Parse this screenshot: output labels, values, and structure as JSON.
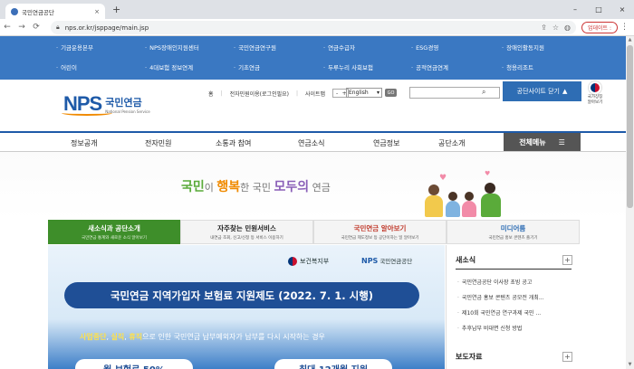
{
  "browser": {
    "tab_title": "국민연금공단",
    "tab_close": "×",
    "new_tab": "+",
    "win_min": "–",
    "win_max": "□",
    "win_close": "×",
    "back": "←",
    "forward": "→",
    "reload": "⟳",
    "url": "nps.or.kr/jsppage/main.jsp",
    "update_button": "업데이트 :",
    "menu": "⋮"
  },
  "site_nav": [
    {
      "label": "기금운용본부"
    },
    {
      "label": "NPS장애인지원센터"
    },
    {
      "label": "국민연금연구원"
    },
    {
      "label": "연금수급자"
    },
    {
      "label": "ESG경영"
    },
    {
      "label": "장애인활동지원"
    },
    {
      "label": "어린이"
    },
    {
      "label": "4대보험 정보연계"
    },
    {
      "label": "기초연금"
    },
    {
      "label": "두루누리 사회보험"
    },
    {
      "label": "공적연금연계"
    },
    {
      "label": "청용리조트"
    }
  ],
  "header": {
    "logo_nps": "NPS",
    "logo_kor": "국민연금",
    "logo_eng": "National Pension Service",
    "util_links": [
      "홈",
      "전자민원이용(로그인필요)",
      "사이트맵"
    ],
    "font_minus": "-",
    "font_plus": "+",
    "language": "English",
    "go_label": "GO",
    "shortcut_label": "공단사이트 닫기",
    "shortcut_arrow": "▲",
    "emblem_line1": "국가상징",
    "emblem_line2": "알아보기"
  },
  "main_menu": [
    {
      "label": "정보공개"
    },
    {
      "label": "전자민원"
    },
    {
      "label": "소통과 참여"
    },
    {
      "label": "연금소식"
    },
    {
      "label": "연금정보"
    },
    {
      "label": "공단소개"
    }
  ],
  "all_menu": {
    "label": "전체메뉴",
    "icon": "☰"
  },
  "hero": {
    "slogan_part1": "국민",
    "slogan_part2": "이 ",
    "slogan_part3": "행복",
    "slogan_part4": "한 국민 ",
    "slogan_part5": "모두의",
    "slogan_part6": " 연금"
  },
  "content_tabs": [
    {
      "title": "새소식과 공단소개",
      "subtitle": "국민연금 통계와 새로운 소식 알아보기",
      "active": true
    },
    {
      "title": "자주찾는 민원서비스",
      "subtitle": "내연금 조회, 신고/신청 등 서비스 이용하기",
      "active": false
    },
    {
      "title": "국민연금 알아보기",
      "subtitle": "국민연금 제도정보 등 공단이하는 일 알아보기",
      "active": false
    },
    {
      "title": "미디어룸",
      "subtitle": "국민연금 홍보 콘텐츠 즐기기",
      "active": false
    }
  ],
  "banner": {
    "ministry": "보건복지부",
    "nps_label": "NPS",
    "nps_name": "국민연금공단",
    "title": "국민연금 지역가입자 보험료 지원제도 (2022. 7. 1. 시행)",
    "sub_pre": "",
    "sub_highlight1": "사업중단",
    "sub_sep1": ", ",
    "sub_highlight2": "실직",
    "sub_sep2": ", ",
    "sub_highlight3": "휴직",
    "sub_post": "으로 인한 국민연금 납부예외자가 납부를 다시 시작하는 경우",
    "bottom_left": "월 보험료 50%",
    "bottom_right": "최대 12개월 지원"
  },
  "sidebar": {
    "news_title": "새소식",
    "plus": "+",
    "news_items": [
      "국민연금공단 이사장 초빙 공고",
      "국민연금 홍보 콘텐츠 공모전 개최...",
      "제10회 국민연금 연구과제 국민 ...",
      "추후납부 비대면 신청 방법"
    ],
    "press_title": "보도자료"
  },
  "colors": {
    "nav_blue": "#3a78c2",
    "brand_blue": "#1e5aa8",
    "brand_orange": "#f08a00",
    "active_green": "#3e8e2a"
  }
}
